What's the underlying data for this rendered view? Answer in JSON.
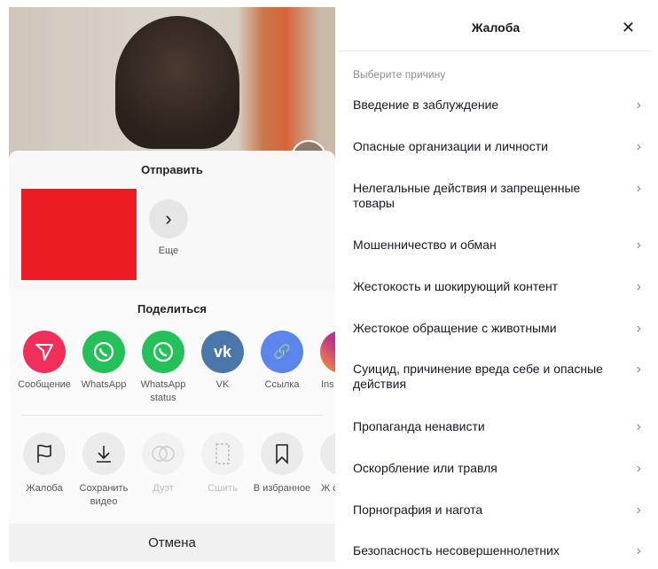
{
  "share_sheet": {
    "send_title": "Отправить",
    "more_label": "Еще",
    "share_title": "Поделиться",
    "share_targets": [
      {
        "label": "Сообщение",
        "icon": "send-icon",
        "color": "#f0305a"
      },
      {
        "label": "WhatsApp",
        "icon": "whatsapp-icon",
        "color": "#25c05a"
      },
      {
        "label": "WhatsApp status",
        "icon": "whatsapp-icon",
        "color": "#25c05a"
      },
      {
        "label": "VK",
        "icon": "vk-icon",
        "color": "#4a76a8"
      },
      {
        "label": "Ссылка",
        "icon": "link-icon",
        "color": "#5b85ea"
      },
      {
        "label": "Ins",
        "icon": "instagram-icon",
        "color": "#c13584"
      }
    ],
    "actions": [
      {
        "label": "Жалоба",
        "icon": "flag-icon"
      },
      {
        "label": "Сохранить видео",
        "icon": "download-icon"
      },
      {
        "label": "Дуэт",
        "icon": "duet-icon",
        "disabled": true
      },
      {
        "label": "Сшить",
        "icon": "stitch-icon",
        "disabled": true
      },
      {
        "label": "В избранное",
        "icon": "bookmark-icon"
      },
      {
        "label": "Ж с",
        "icon": "more-icon"
      }
    ],
    "cancel": "Отмена"
  },
  "report": {
    "title": "Жалоба",
    "subtitle": "Выберите причину",
    "reasons": [
      "Введение в заблуждение",
      "Опасные организации и личности",
      "Нелегальные действия и запрещенные товары",
      "Мошенничество и обман",
      "Жестокость и шокирующий контент",
      "Жестокое обращение с животными",
      "Суицид, причинение вреда себе и опасные действия",
      "Пропаганда ненависти",
      "Оскорбление или травля",
      "Порнография и нагота",
      "Безопасность несовершеннолетних"
    ]
  }
}
